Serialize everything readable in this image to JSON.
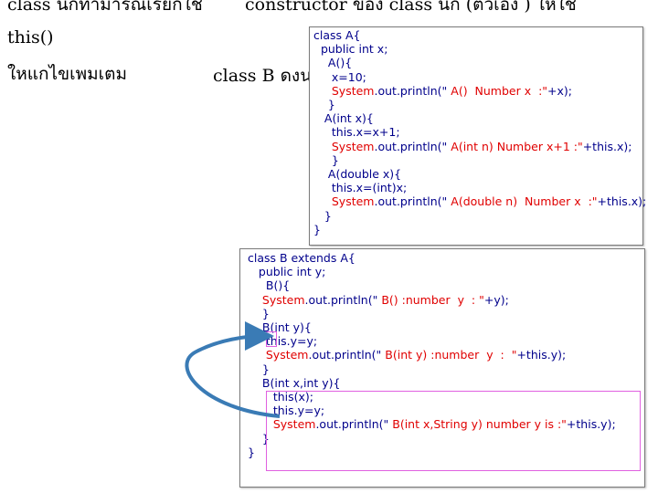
{
  "slide": {
    "top_left": "class นกทำมารณเรยกใช",
    "top_right": "constructor ของ class นก  (ตวเอง  ) ใหใช",
    "this_label": "this()",
    "note": "ใหแกไขเพมเตม",
    "class_b_label": "class B ดงน"
  },
  "code_a": [
    [
      {
        "t": "class A{",
        "c": "dk"
      }
    ],
    [
      {
        "t": "  public int x;",
        "c": "dk"
      }
    ],
    [
      {
        "t": "    A(){",
        "c": "dk"
      }
    ],
    [
      {
        "t": "     x=10;",
        "c": "dk"
      }
    ],
    [
      {
        "t": "     ",
        "c": "dk"
      },
      {
        "t": "System",
        "c": "red"
      },
      {
        "t": ".out.println(\"",
        "c": "dk"
      },
      {
        "t": " A()  Number x  :\"",
        "c": "red"
      },
      {
        "t": "+x);",
        "c": "dk"
      }
    ],
    [
      {
        "t": "    }",
        "c": "dk"
      }
    ],
    [
      {
        "t": "   A(int x){",
        "c": "dk"
      }
    ],
    [
      {
        "t": "     this.x=x+1;",
        "c": "dk"
      }
    ],
    [
      {
        "t": "     ",
        "c": "dk"
      },
      {
        "t": "System",
        "c": "red"
      },
      {
        "t": ".out.println(\"",
        "c": "dk"
      },
      {
        "t": " A(int n) Number x+1 :\"",
        "c": "red"
      },
      {
        "t": "+this.x);",
        "c": "dk"
      }
    ],
    [
      {
        "t": "     }",
        "c": "dk"
      }
    ],
    [
      {
        "t": "    A(double x){",
        "c": "dk"
      }
    ],
    [
      {
        "t": "     this.x=(int)x;",
        "c": "dk"
      }
    ],
    [
      {
        "t": "     ",
        "c": "dk"
      },
      {
        "t": "System",
        "c": "red"
      },
      {
        "t": ".out.println(\"",
        "c": "dk"
      },
      {
        "t": " A(double n)  Number x  :\"",
        "c": "red"
      },
      {
        "t": "+this.x);",
        "c": "dk"
      }
    ],
    [
      {
        "t": "   }",
        "c": "dk"
      }
    ],
    [
      {
        "t": "}",
        "c": "dk"
      }
    ]
  ],
  "code_b": [
    [
      {
        "t": "class B extends A{",
        "c": "dk"
      }
    ],
    [
      {
        "t": "   public int y;",
        "c": "dk"
      }
    ],
    [
      {
        "t": "     B(){",
        "c": "dk"
      }
    ],
    [
      {
        "t": "    ",
        "c": "dk"
      },
      {
        "t": "System",
        "c": "red"
      },
      {
        "t": ".out.println(\"",
        "c": "dk"
      },
      {
        "t": " B() :number  y  : \"",
        "c": "red"
      },
      {
        "t": "+y);",
        "c": "dk"
      }
    ],
    [
      {
        "t": "    }",
        "c": "dk"
      }
    ],
    [
      {
        "t": "    B(int y){",
        "c": "dk"
      }
    ],
    [
      {
        "t": "     this.y=y;",
        "c": "dk"
      }
    ],
    [
      {
        "t": "     ",
        "c": "dk"
      },
      {
        "t": "System",
        "c": "red"
      },
      {
        "t": ".out.println(\"",
        "c": "dk"
      },
      {
        "t": " B(int y) :number  y  :  \"",
        "c": "red"
      },
      {
        "t": "+this.y);",
        "c": "dk"
      }
    ],
    [
      {
        "t": "    }",
        "c": "dk"
      }
    ],
    [
      {
        "t": "    B(int x,int y){",
        "c": "dk"
      }
    ],
    [
      {
        "t": "       this(x);",
        "c": "dk"
      }
    ],
    [
      {
        "t": "       this.y=y;",
        "c": "dk"
      }
    ],
    [
      {
        "t": "       ",
        "c": "dk"
      },
      {
        "t": "System",
        "c": "red"
      },
      {
        "t": ".out.println(\"",
        "c": "dk"
      },
      {
        "t": " B(int x,String y) number y is :\"",
        "c": "red"
      },
      {
        "t": "+this.y);",
        "c": "dk"
      }
    ],
    [
      {
        "t": "    }",
        "c": "dk"
      }
    ],
    [
      {
        "t": "}",
        "c": "dk"
      }
    ]
  ],
  "colors": {
    "keyword": "#00008b",
    "string": "#e00000",
    "arrow": "#3a7bb5",
    "highlight": "#e060e0"
  }
}
